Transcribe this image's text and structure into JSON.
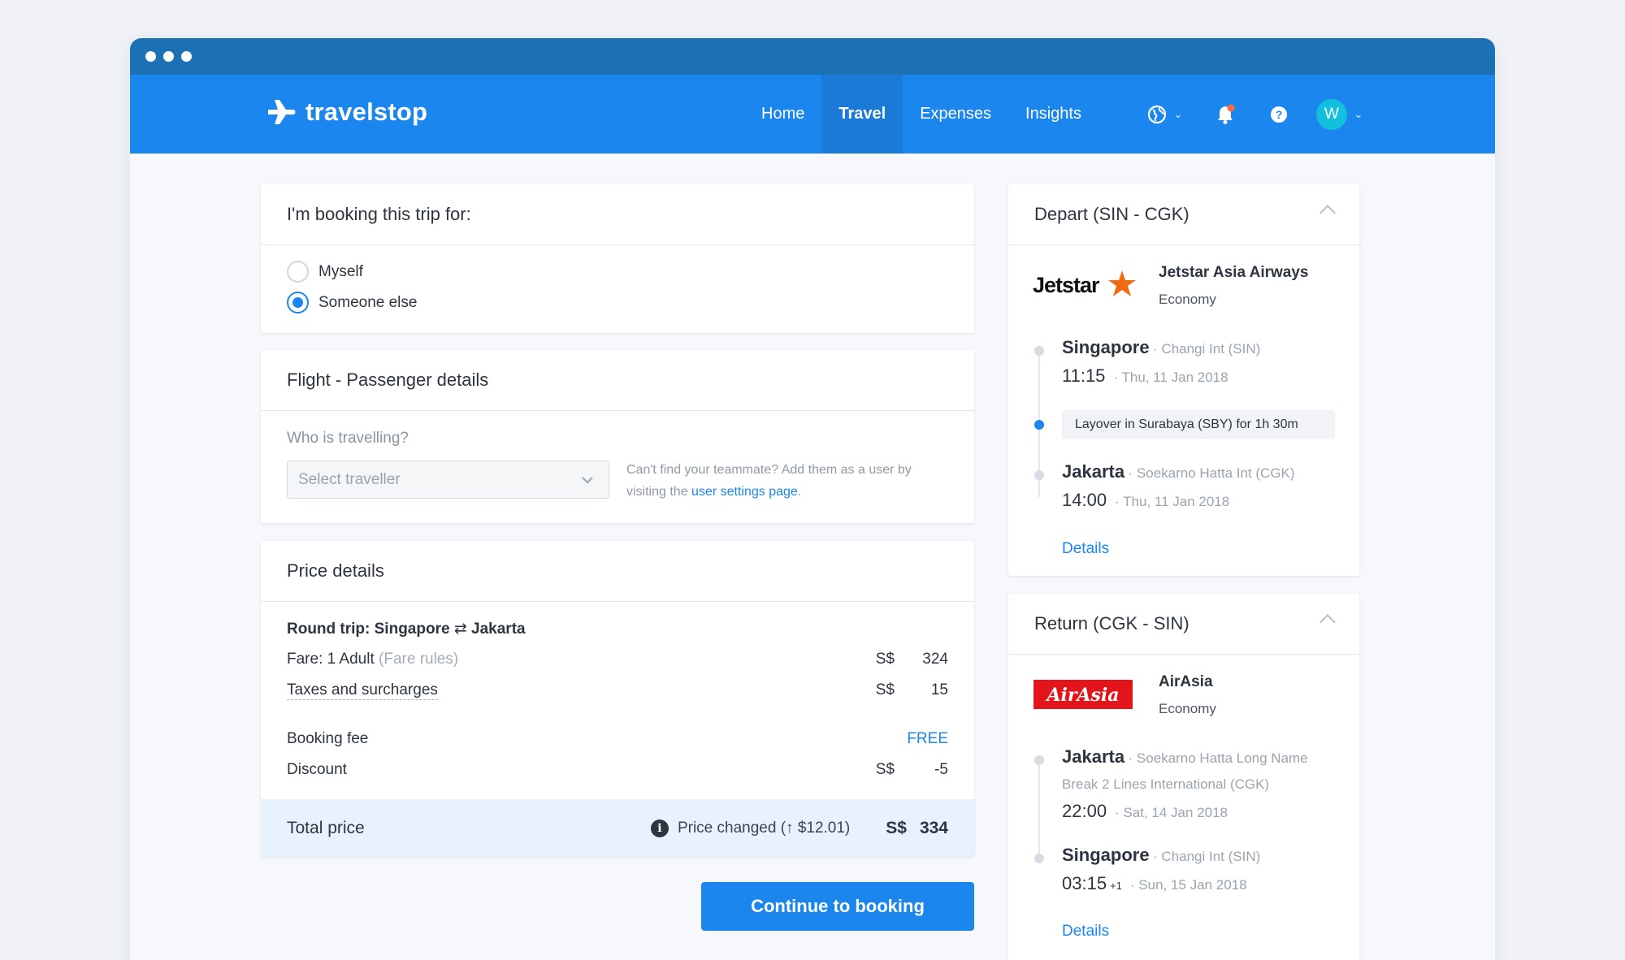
{
  "app": {
    "brand": "travelstop",
    "nav": [
      "Home",
      "Travel",
      "Expenses",
      "Insights"
    ],
    "active_nav": "Travel",
    "user_initial": "W"
  },
  "booking_for": {
    "title": "I'm booking this trip for:",
    "options": [
      "Myself",
      "Someone else"
    ],
    "selected": "Someone else"
  },
  "passenger": {
    "title": "Flight - Passenger details",
    "who_label": "Who is travelling?",
    "select_placeholder": "Select traveller",
    "hint_text": "Can't find your teammate? Add them as a user by visiting the",
    "hint_link": "user settings page",
    "hint_end": "."
  },
  "price": {
    "title": "Price details",
    "route_prefix": "Round trip: Singapore",
    "route_icon": "⇄",
    "route_dest": "Jakarta",
    "fare_label": "Fare: 1 Adult",
    "fare_rules": "(Fare rules)",
    "fare_currency": "S$",
    "fare_value": "324",
    "taxes_label": "Taxes and surcharges",
    "taxes_currency": "S$",
    "taxes_value": "15",
    "booking_fee_label": "Booking fee",
    "booking_fee_value": "FREE",
    "discount_label": "Discount",
    "discount_currency": "S$",
    "discount_value": "-5",
    "total_label": "Total price",
    "changed_prefix": "Price changed (",
    "changed_arrow": "↑",
    "changed_amount": "$12.01)",
    "total_currency": "S$",
    "total_value": "334"
  },
  "cta_label": "Continue to booking",
  "depart": {
    "title": "Depart (SIN - CGK)",
    "airline": "Jetstar Asia Airways",
    "logo_text": "Jetstar",
    "cabin": "Economy",
    "from_city": "Singapore",
    "from_airport": "· Changi Int (SIN)",
    "from_time": "11:15",
    "from_date": "· Thu, 11 Jan 2018",
    "layover": "Layover in Surabaya (SBY) for 1h 30m",
    "to_city": "Jakarta",
    "to_airport": "· Soekarno Hatta Int (CGK)",
    "to_time": "14:00",
    "to_date": "· Thu, 11 Jan 2018",
    "details": "Details"
  },
  "return": {
    "title": "Return (CGK - SIN)",
    "airline": "AirAsia",
    "logo_text": "AirAsia",
    "cabin": "Economy",
    "from_city": "Jakarta",
    "from_airport": "· Soekarno Hatta Long Name Break 2 Lines International (CGK)",
    "from_time": "22:00",
    "from_date": "· Sat, 14 Jan 2018",
    "to_city": "Singapore",
    "to_airport": "· Changi Int (SIN)",
    "to_time": "03:15",
    "to_day_offset": "+1",
    "to_date": "· Sun, 15 Jan 2018",
    "details": "Details"
  },
  "colors": {
    "primary": "#1a86ee",
    "titlebar": "#1c71b5",
    "jetstar_orange": "#f26a10",
    "airasia_red": "#e3151b"
  }
}
